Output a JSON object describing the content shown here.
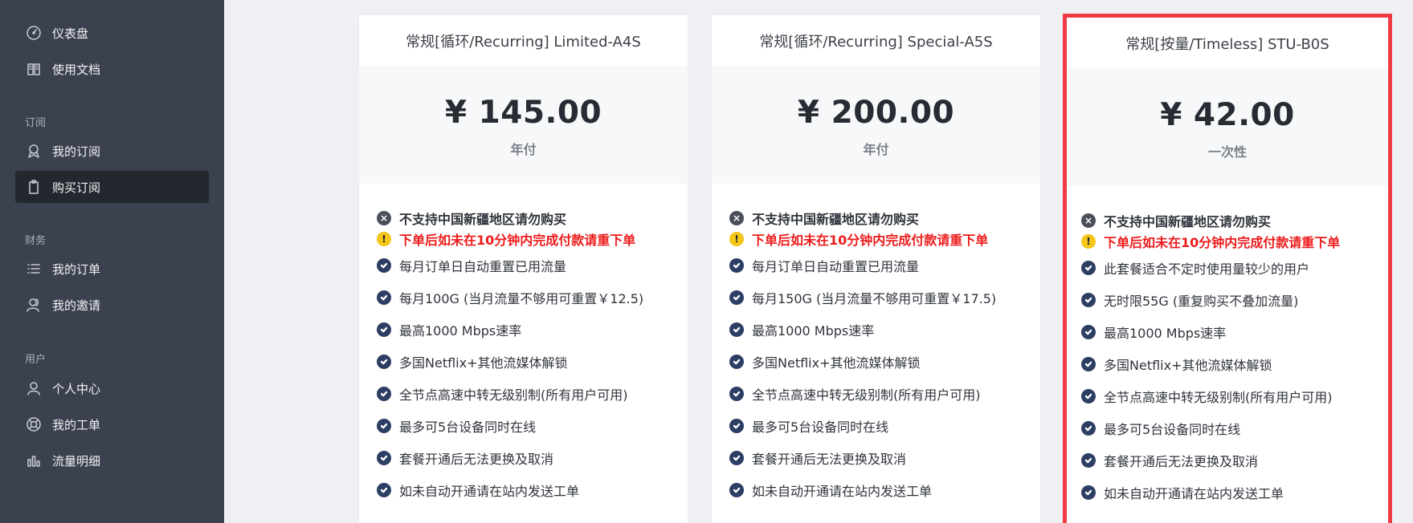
{
  "sidebar": {
    "items": [
      {
        "label": "仪表盘",
        "icon": "gauge-icon"
      },
      {
        "label": "使用文档",
        "icon": "book-icon"
      },
      {
        "label": "我的订阅",
        "icon": "award-icon"
      },
      {
        "label": "购买订阅",
        "icon": "clipboard-icon"
      },
      {
        "label": "我的订单",
        "icon": "list-icon"
      },
      {
        "label": "我的邀请",
        "icon": "users-icon"
      },
      {
        "label": "个人中心",
        "icon": "user-icon"
      },
      {
        "label": "我的工单",
        "icon": "lifebuoy-icon"
      },
      {
        "label": "流量明细",
        "icon": "bar-chart-icon"
      }
    ],
    "sections": [
      "订阅",
      "财务",
      "用户"
    ],
    "active": "购买订阅"
  },
  "plans": [
    {
      "title": "常规[循环/Recurring] Limited-A4S",
      "price": "¥ 145.00",
      "period": "年付",
      "notice_x": "不支持中国新疆地区请勿购买",
      "notice_warn": "下单后如未在10分钟内完成付款请重下单",
      "features": [
        "每月订单日自动重置已用流量",
        "每月100G (当月流量不够用可重置￥12.5)",
        "最高1000 Mbps速率",
        "多国Netflix+其他流媒体解锁",
        "全节点高速中转无级别制(所有用户可用)",
        "最多可5台设备同时在线",
        "套餐开通后无法更换及取消",
        "如未自动开通请在站内发送工单"
      ]
    },
    {
      "title": "常规[循环/Recurring] Special-A5S",
      "price": "¥ 200.00",
      "period": "年付",
      "notice_x": "不支持中国新疆地区请勿购买",
      "notice_warn": "下单后如未在10分钟内完成付款请重下单",
      "features": [
        "每月订单日自动重置已用流量",
        "每月150G (当月流量不够用可重置￥17.5)",
        "最高1000 Mbps速率",
        "多国Netflix+其他流媒体解锁",
        "全节点高速中转无级别制(所有用户可用)",
        "最多可5台设备同时在线",
        "套餐开通后无法更换及取消",
        "如未自动开通请在站内发送工单"
      ]
    },
    {
      "title": "常规[按量/Timeless] STU-B0S",
      "price": "¥ 42.00",
      "period": "一次性",
      "notice_x": "不支持中国新疆地区请勿购买",
      "notice_warn": "下单后如未在10分钟内完成付款请重下单",
      "features": [
        "此套餐适合不定时使用量较少的用户",
        "无时限55G (重复购买不叠加流量)",
        "最高1000 Mbps速率",
        "多国Netflix+其他流媒体解锁",
        "全节点高速中转无级别制(所有用户可用)",
        "最多可5台设备同时在线",
        "套餐开通后无法更换及取消",
        "如未自动开通请在站内发送工单"
      ]
    }
  ],
  "colors": {
    "sidebar_bg": "#3b414f",
    "active_bg": "#23272e",
    "highlight": "#ef3b43",
    "warn_text": "#ee1c1c"
  }
}
